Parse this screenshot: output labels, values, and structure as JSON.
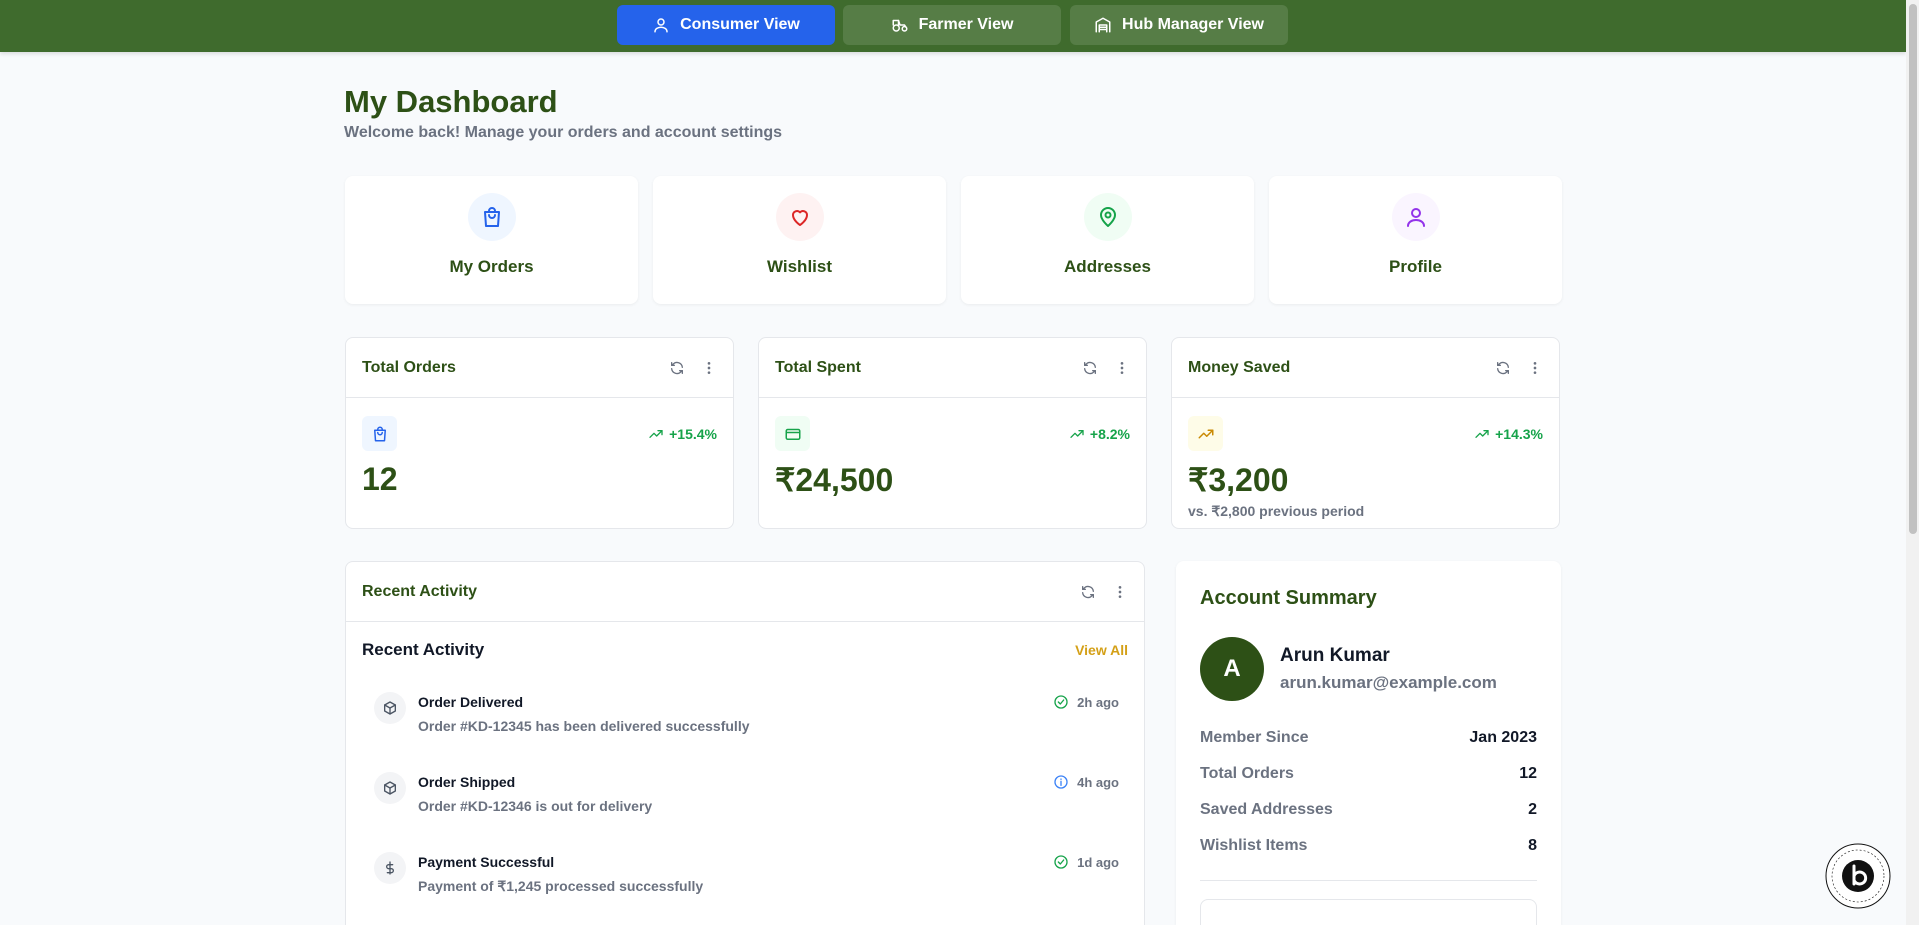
{
  "topbar": {
    "views": [
      {
        "label": "Consumer View",
        "icon": "user-icon",
        "active": true
      },
      {
        "label": "Farmer View",
        "icon": "tractor-icon",
        "active": false
      },
      {
        "label": "Hub Manager View",
        "icon": "warehouse-icon",
        "active": false
      }
    ]
  },
  "header": {
    "title": "My Dashboard",
    "subtitle": "Welcome back! Manage your orders and account settings"
  },
  "quick_links": [
    {
      "label": "My Orders",
      "icon": "shopping-bag-icon",
      "color": "#2563eb"
    },
    {
      "label": "Wishlist",
      "icon": "heart-icon",
      "color": "#dc2626"
    },
    {
      "label": "Addresses",
      "icon": "map-pin-icon",
      "color": "#16a34a"
    },
    {
      "label": "Profile",
      "icon": "user-icon",
      "color": "#9333ea"
    }
  ],
  "stats": [
    {
      "title": "Total Orders",
      "value": "12",
      "trend": "+15.4%",
      "note": "",
      "icon": "shopping-bag-icon"
    },
    {
      "title": "Total Spent",
      "value": "₹24,500",
      "trend": "+8.2%",
      "note": "",
      "icon": "credit-card-icon"
    },
    {
      "title": "Money Saved",
      "value": "₹3,200",
      "trend": "+14.3%",
      "note": "vs. ₹2,800 previous period",
      "icon": "trending-up-icon"
    }
  ],
  "activity": {
    "card_title": "Recent Activity",
    "sub_title": "Recent Activity",
    "view_all": "View All",
    "items": [
      {
        "title": "Order Delivered",
        "desc": "Order #KD-12345 has been delivered successfully",
        "time": "2h ago",
        "icon": "package-icon",
        "status_icon": "check-circle-icon"
      },
      {
        "title": "Order Shipped",
        "desc": "Order #KD-12346 is out for delivery",
        "time": "4h ago",
        "icon": "package-icon",
        "status_icon": "info-icon"
      },
      {
        "title": "Payment Successful",
        "desc": "Payment of ₹1,245 processed successfully",
        "time": "1d ago",
        "icon": "dollar-icon",
        "status_icon": "check-circle-icon"
      }
    ]
  },
  "account_summary": {
    "title": "Account Summary",
    "avatar_initial": "A",
    "name": "Arun Kumar",
    "email": "arun.kumar@example.com",
    "rows": [
      {
        "label": "Member Since",
        "value": "Jan 2023"
      },
      {
        "label": "Total Orders",
        "value": "12"
      },
      {
        "label": "Saved Addresses",
        "value": "2"
      },
      {
        "label": "Wishlist Items",
        "value": "8"
      }
    ]
  },
  "colors": {
    "brand_green": "#3f6b2d",
    "heading_green": "#2d5016",
    "active_blue": "#2563eb",
    "trend_green": "#16a34a",
    "accent_gold": "#d4a017"
  }
}
